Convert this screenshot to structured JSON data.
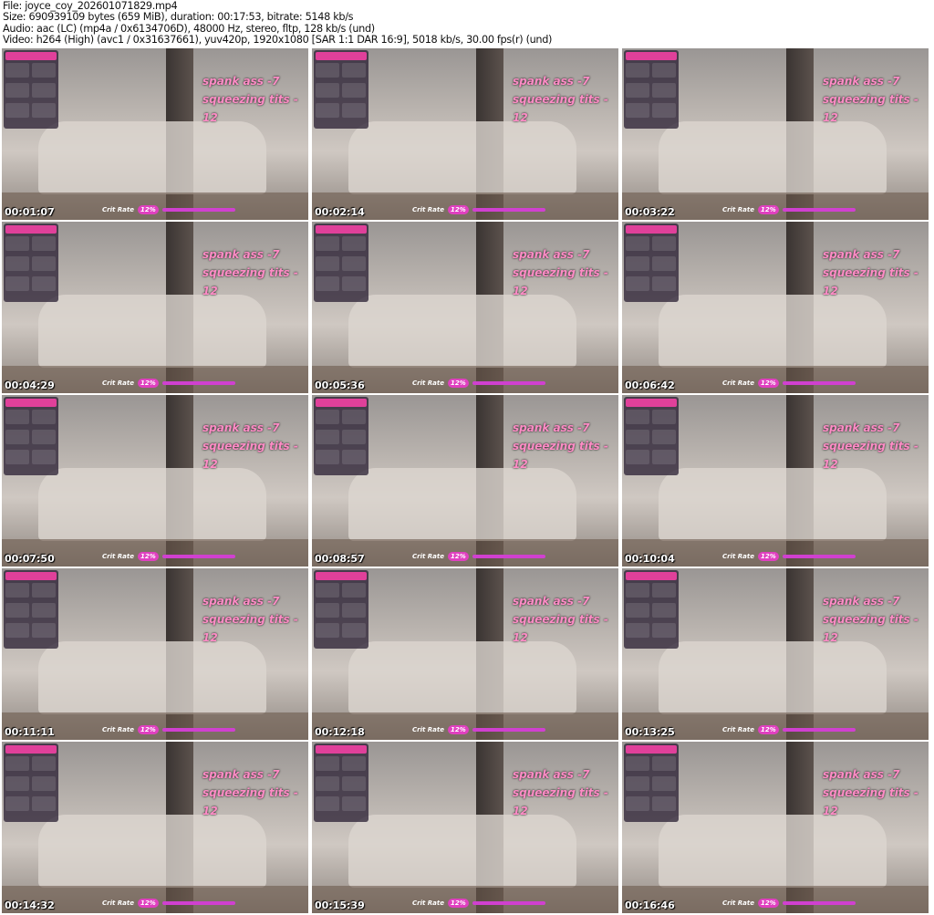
{
  "header": {
    "file": "File: joyce_coy_202601071829.mp4",
    "size": "Size: 690939109 bytes (659 MiB), duration: 00:17:53, bitrate: 5148 kb/s",
    "audio": "Audio: aac (LC) (mp4a / 0x6134706D), 48000 Hz, stereo, fltp, 128 kb/s (und)",
    "video": "Video: h264 (High) (avc1 / 0x31637661), yuv420p, 1920x1080 [SAR 1:1 DAR 16:9], 5018 kb/s, 30.00 fps(r) (und)"
  },
  "overlay": {
    "menu1": "spank ass -7",
    "menu2": "squeezing tits - 12",
    "crit_label": "Crit Rate",
    "crit_pct": "12%"
  },
  "timestamps": [
    "00:01:07",
    "00:02:14",
    "00:03:22",
    "00:04:29",
    "00:05:36",
    "00:06:42",
    "00:07:50",
    "00:08:57",
    "00:10:04",
    "00:11:11",
    "00:12:18",
    "00:13:25",
    "00:14:32",
    "00:15:39",
    "00:16:46"
  ]
}
